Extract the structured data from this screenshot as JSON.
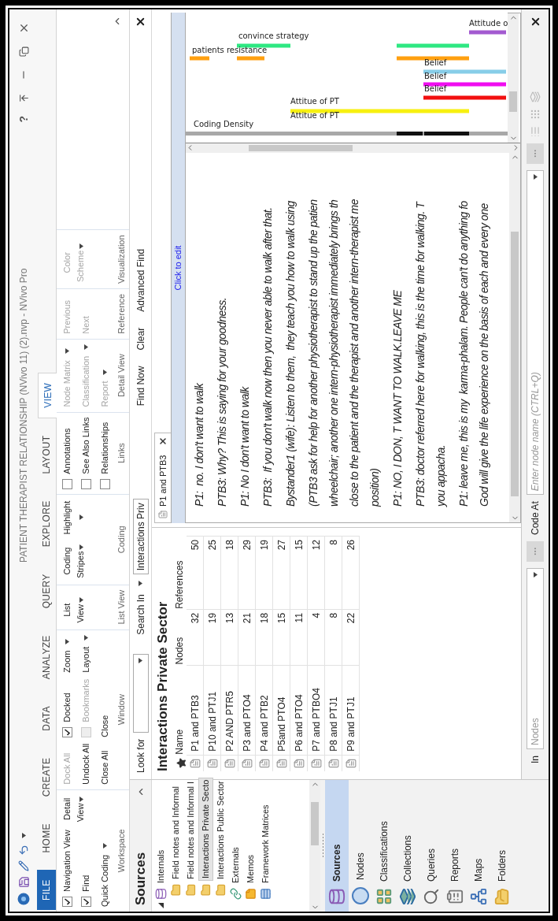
{
  "window": {
    "title": "PATIENT THERAPIST RELATIONSHIP (NVivo 11) (2).nvp - NVivo Pro",
    "help": "?"
  },
  "ribbon_tabs": [
    {
      "label": "FILE",
      "kind": "file",
      "selected": false
    },
    {
      "label": "HOME",
      "kind": "tab",
      "selected": false
    },
    {
      "label": "CREATE",
      "kind": "tab",
      "selected": false
    },
    {
      "label": "DATA",
      "kind": "tab",
      "selected": false
    },
    {
      "label": "ANALYZE",
      "kind": "tab",
      "selected": false
    },
    {
      "label": "QUERY",
      "kind": "tab",
      "selected": false
    },
    {
      "label": "EXPLORE",
      "kind": "tab",
      "selected": false
    },
    {
      "label": "LAYOUT",
      "kind": "tab",
      "selected": false
    },
    {
      "label": "VIEW",
      "kind": "tab",
      "selected": true
    }
  ],
  "ribbon_groups": [
    {
      "label": "Workspace",
      "columns": [
        [
          {
            "kind": "check",
            "label": "Navigation View",
            "checked": true,
            "disabled": false
          },
          {
            "kind": "check",
            "label": "Find",
            "checked": true,
            "disabled": false
          },
          {
            "kind": "small",
            "label": "Quick Coding",
            "dropdown": true,
            "disabled": false
          }
        ],
        [
          {
            "kind": "large",
            "label": "Detail View",
            "dropdown": true,
            "disabled": false
          }
        ]
      ]
    },
    {
      "label": "Window",
      "columns": [
        [
          {
            "kind": "small",
            "label": "Dock All",
            "dropdown": false,
            "disabled": true
          },
          {
            "kind": "small",
            "label": "Undock All",
            "dropdown": false,
            "disabled": false
          },
          {
            "kind": "small",
            "label": "Close All",
            "dropdown": false,
            "disabled": false
          }
        ],
        [
          {
            "kind": "check",
            "label": "Docked",
            "checked": true,
            "disabled": false
          },
          {
            "kind": "check",
            "label": "Bookmarks",
            "checked": false,
            "disabled": true
          },
          {
            "kind": "small",
            "label": "Close",
            "dropdown": false,
            "disabled": false
          }
        ],
        [
          {
            "kind": "small",
            "label": "Zoom",
            "dropdown": true,
            "disabled": false
          },
          {
            "kind": "small",
            "label": "Layout",
            "dropdown": true,
            "disabled": false
          }
        ]
      ]
    },
    {
      "label": "List View",
      "columns": [
        [
          {
            "kind": "large",
            "label": "List View",
            "dropdown": true,
            "disabled": false
          }
        ]
      ]
    },
    {
      "label": "Coding",
      "columns": [
        [
          {
            "kind": "large",
            "label": "Coding Stripes",
            "dropdown": true,
            "disabled": false
          }
        ],
        [
          {
            "kind": "large",
            "label": "Highlight",
            "dropdown": true,
            "disabled": false
          }
        ]
      ]
    },
    {
      "label": "Links",
      "columns": [
        [
          {
            "kind": "check",
            "label": "Annotations",
            "checked": false,
            "disabled": false
          },
          {
            "kind": "check",
            "label": "See Also Links",
            "checked": false,
            "disabled": false
          },
          {
            "kind": "check",
            "label": "Relationships",
            "checked": false,
            "disabled": false
          }
        ]
      ]
    },
    {
      "label": "Detail View",
      "columns": [
        [
          {
            "kind": "small",
            "label": "Node Matrix",
            "dropdown": true,
            "disabled": true
          },
          {
            "kind": "small",
            "label": "Classification",
            "dropdown": true,
            "disabled": true
          },
          {
            "kind": "small",
            "label": "Report",
            "dropdown": true,
            "disabled": true
          }
        ]
      ]
    },
    {
      "label": "Reference",
      "columns": [
        [
          {
            "kind": "small",
            "label": "Previous",
            "dropdown": false,
            "disabled": true
          },
          {
            "kind": "small",
            "label": "Next",
            "dropdown": false,
            "disabled": true
          }
        ]
      ]
    },
    {
      "label": "Visualization",
      "columns": [
        [
          {
            "kind": "large",
            "label": "Color Scheme",
            "dropdown": true,
            "disabled": true
          }
        ]
      ]
    }
  ],
  "navigation": {
    "header": "Sources",
    "tree": [
      {
        "label": "Internals",
        "kind": "internals",
        "expanded": true,
        "selected": false,
        "children": [
          {
            "label": "Field notes and  Informal",
            "kind": "folder",
            "selected": false
          },
          {
            "label": "Field notes and Informal I",
            "kind": "folder",
            "selected": false
          },
          {
            "label": "Interactions Private Secto",
            "kind": "folder",
            "selected": true
          },
          {
            "label": "Interactions Public Sector",
            "kind": "folder",
            "selected": false
          }
        ]
      },
      {
        "label": "Externals",
        "kind": "externals",
        "selected": false
      },
      {
        "label": "Memos",
        "kind": "memos",
        "selected": false
      },
      {
        "label": "Framework Matrices",
        "kind": "matrices",
        "selected": false
      }
    ],
    "buttons": [
      {
        "label": "Sources",
        "selected": true
      },
      {
        "label": "Nodes",
        "selected": false
      },
      {
        "label": "Classifications",
        "selected": false
      },
      {
        "label": "Collections",
        "selected": false
      },
      {
        "label": "Queries",
        "selected": false
      },
      {
        "label": "Reports",
        "selected": false
      },
      {
        "label": "Maps",
        "selected": false
      },
      {
        "label": "Folders",
        "selected": false
      }
    ]
  },
  "find_bar": {
    "look_for": "Look for",
    "search_in": "Search In",
    "scope": "Interactions Priv",
    "buttons": [
      "Find Now",
      "Clear",
      "Advanced Find"
    ]
  },
  "list_view": {
    "title": "Interactions Private Sector",
    "columns": [
      "Name",
      "Nodes",
      "References"
    ],
    "rows": [
      {
        "name": "P1 and PTB3",
        "nodes": "32",
        "references": "50"
      },
      {
        "name": "P10 and PTJ1",
        "nodes": "19",
        "references": "25"
      },
      {
        "name": "P2 AND PTR5",
        "nodes": "13",
        "references": "18"
      },
      {
        "name": "P3 and PTO4",
        "nodes": "21",
        "references": "29"
      },
      {
        "name": "P4 and PTB2",
        "nodes": "18",
        "references": "19"
      },
      {
        "name": "P5and PTO4",
        "nodes": "15",
        "references": "27"
      },
      {
        "name": "P6 and PTO4",
        "nodes": "11",
        "references": "15"
      },
      {
        "name": "P7 and PTBO4",
        "nodes": "4",
        "references": "12"
      },
      {
        "name": "P8 and PTJ1",
        "nodes": "8",
        "references": "8"
      },
      {
        "name": "P9 and PTJ1",
        "nodes": "22",
        "references": "26"
      }
    ]
  },
  "detail": {
    "tab": "P1 and PTB3",
    "edit_hint": "Click to edit",
    "paragraphs": [
      [
        "P1:  no. I don't want to walk"
      ],
      [
        "PTB3: Why? This is saying for your goodness."
      ],
      [
        "P1: No I don't want to walk"
      ],
      [
        "PTB3:  If you don't walk now then you never able to walk after that."
      ],
      [
        "Bystander1 (wife): Listen to them,  they teach you how to walk using"
      ],
      [
        "(PTB3 ask for help for another physiotherapist to stand up the patien",
        "wheelchair; another one intern-physiotherapist immediately brings th",
        "close to the patient and the therapist and another intern-therapist me",
        "position)"
      ],
      [
        "P1: NO, I DON, T WANT TO WALK.LEAVE ME"
      ],
      [
        "PTB3: doctor referred here for walking, this is the time for walking. T",
        "you appacha."
      ],
      [
        "P1: leave me, this is my  karma-phalam. People can't do anything fo",
        "God will give the life experience on the basis of each and every one"
      ]
    ],
    "stripes": [
      {
        "label": "Attitude o",
        "color": "#a35ad0"
      },
      {
        "label": "convince strategy",
        "color": "#2ee882"
      },
      {
        "label": "patients resistance",
        "color": "#ffa010"
      },
      {
        "label": "Belief",
        "color": "#87cde8"
      },
      {
        "label": "Belief",
        "color": "#f00df0"
      },
      {
        "label": "Belief",
        "color": "#f21010"
      },
      {
        "label": "Attitue of PT",
        "color": "#f7f010"
      },
      {
        "label": "Attitue of PT"
      }
    ],
    "density_label": "Coding Density"
  },
  "status_bar": {
    "in_label": "In",
    "in_placeholder": "Nodes",
    "code_at": "Code At",
    "node_placeholder": "Enter node name (CTRL+Q)"
  }
}
